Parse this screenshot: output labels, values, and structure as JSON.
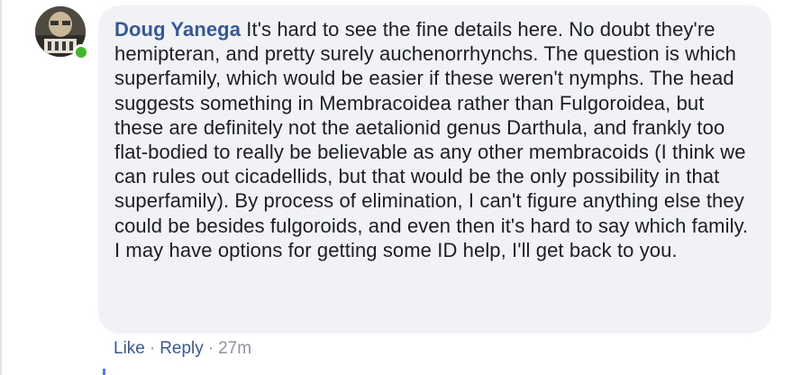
{
  "comment": {
    "author": "Doug Yanega",
    "body": "It's hard to see the fine details here. No doubt they're hemipteran, and pretty surely auchenorrhynchs. The question is which superfamily, which would be easier if these weren't nymphs. The head suggests something in Membracoidea rather than Fulgoroidea, but these are definitely not the aetalionid genus Darthula, and frankly too flat-bodied to really be believable as any other membracoids (I think we can rules out cicadellids, but that would be the only possibility in that superfamily). By process of elimination, I can't figure anything else they could be besides fulgoroids, and even then it's hard to say which family. I may have options for getting some ID help, I'll get back to you.",
    "online": true
  },
  "actions": {
    "like_label": "Like",
    "separator": "·",
    "reply_label": "Reply",
    "timestamp": "27m"
  },
  "colors": {
    "bubble_bg": "#f0f2f5",
    "author_link": "#365899",
    "online_status": "#42b72a",
    "muted_text": "#8d949e"
  }
}
